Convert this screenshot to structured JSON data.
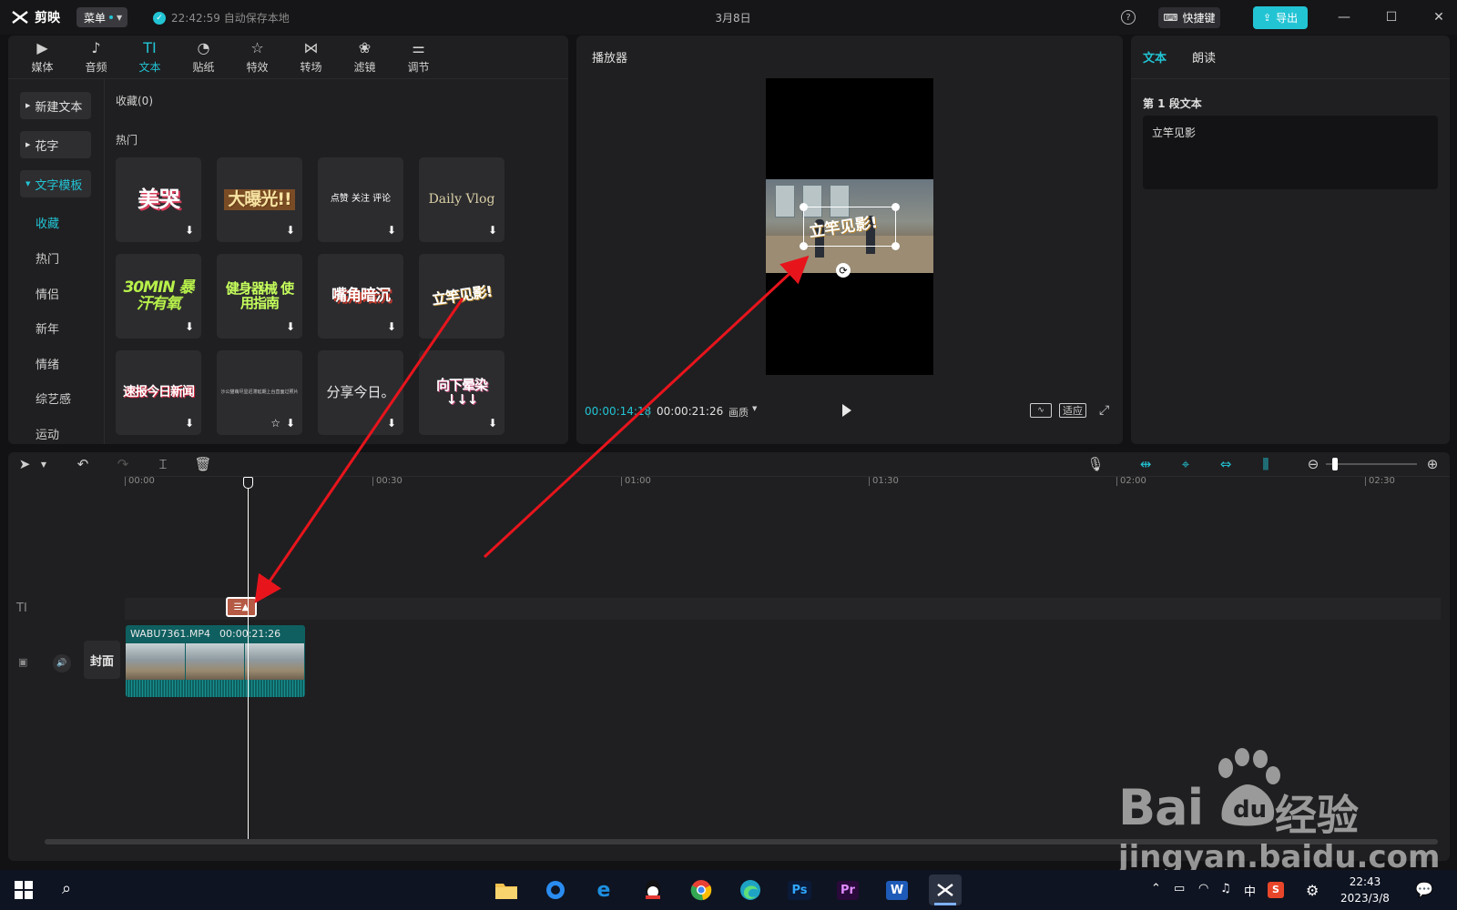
{
  "titlebar": {
    "app_name": "剪映",
    "menu_label": "菜单",
    "save_status": "22:42:59 自动保存本地",
    "project_title": "3月8日",
    "shortcut_label": "快捷键",
    "export_label": "导出"
  },
  "tool_tabs": [
    {
      "label": "媒体",
      "icon": "media-icon"
    },
    {
      "label": "音频",
      "icon": "audio-icon"
    },
    {
      "label": "文本",
      "icon": "text-icon",
      "glyph": "TI"
    },
    {
      "label": "贴纸",
      "icon": "sticker-icon"
    },
    {
      "label": "特效",
      "icon": "effects-icon"
    },
    {
      "label": "转场",
      "icon": "transition-icon"
    },
    {
      "label": "滤镜",
      "icon": "filter-icon"
    },
    {
      "label": "调节",
      "icon": "adjust-icon"
    }
  ],
  "sidebar": {
    "categories": [
      "新建文本",
      "花字",
      "文字模板"
    ],
    "subitems": [
      "收藏",
      "热门",
      "情侣",
      "新年",
      "情绪",
      "综艺感",
      "运动"
    ]
  },
  "library": {
    "favorites_label": "收藏(0)",
    "hot_label": "热门",
    "cards": [
      {
        "art": "美哭"
      },
      {
        "art": "大曝光!!"
      },
      {
        "art": "点赞 关注 评论"
      },
      {
        "art": "Daily Vlog"
      },
      {
        "art": "30MIN 暴汗有氧"
      },
      {
        "art": "健身器械 使用指南"
      },
      {
        "art": "嘴角暗沉"
      },
      {
        "art": "立竿见影!"
      },
      {
        "art": "速报今日新闻"
      },
      {
        "art": "沙公猫萌尽显迟滞延期上台直面过照片"
      },
      {
        "art": "分享今日。"
      },
      {
        "art": "向下晕染 ↓↓↓"
      }
    ]
  },
  "player": {
    "title": "播放器",
    "overlay_text": "立竿见影!",
    "current_time": "00:00:14:18",
    "total_time": "00:00:21:26",
    "quality_label": "画质",
    "fit_label": "适应"
  },
  "props": {
    "tab_text": "文本",
    "tab_read": "朗读",
    "segment_label": "第 1 段文本",
    "segment_value": "立竿见影"
  },
  "timeline": {
    "ruler": [
      "00:00",
      "00:30",
      "01:00",
      "01:30",
      "02:00",
      "02:30"
    ],
    "text_track_icon": "TI",
    "cover_label": "封面",
    "clip_name": "WABU7361.MP4",
    "clip_duration": "00:00:21:26"
  },
  "watermark": {
    "brand": "Bai",
    "du": "du",
    "jingyan": "经验",
    "url": "jingyan.baidu.com"
  },
  "taskbar": {
    "ime": "中",
    "clock_time": "22:43",
    "clock_date": "2023/3/8",
    "apps": [
      {
        "name": "file-explorer-icon",
        "label": "",
        "color": "#f2c14e"
      },
      {
        "name": "qq-browser-icon",
        "label": "",
        "color": "#2a8cf0"
      },
      {
        "name": "edge-legacy-icon",
        "label": "e",
        "color": "#1e8fe0"
      },
      {
        "name": "qq-icon",
        "label": "",
        "color": "#111111"
      },
      {
        "name": "chrome-icon",
        "label": "",
        "color": "#e94235"
      },
      {
        "name": "edge-icon",
        "label": "",
        "color": "#1fa3c4"
      },
      {
        "name": "photoshop-icon",
        "label": "Ps",
        "color": "#0a1a38"
      },
      {
        "name": "premiere-icon",
        "label": "Pr",
        "color": "#2a0a3a"
      },
      {
        "name": "word-icon",
        "label": "W",
        "color": "#1e5bb8"
      },
      {
        "name": "capcut-icon",
        "label": "",
        "color": "#111111"
      }
    ]
  },
  "colors": {
    "accent": "#22c4d4",
    "arrow": "#e8141c",
    "text_clip": "#b55a44",
    "video_clip": "#0f5f60"
  }
}
